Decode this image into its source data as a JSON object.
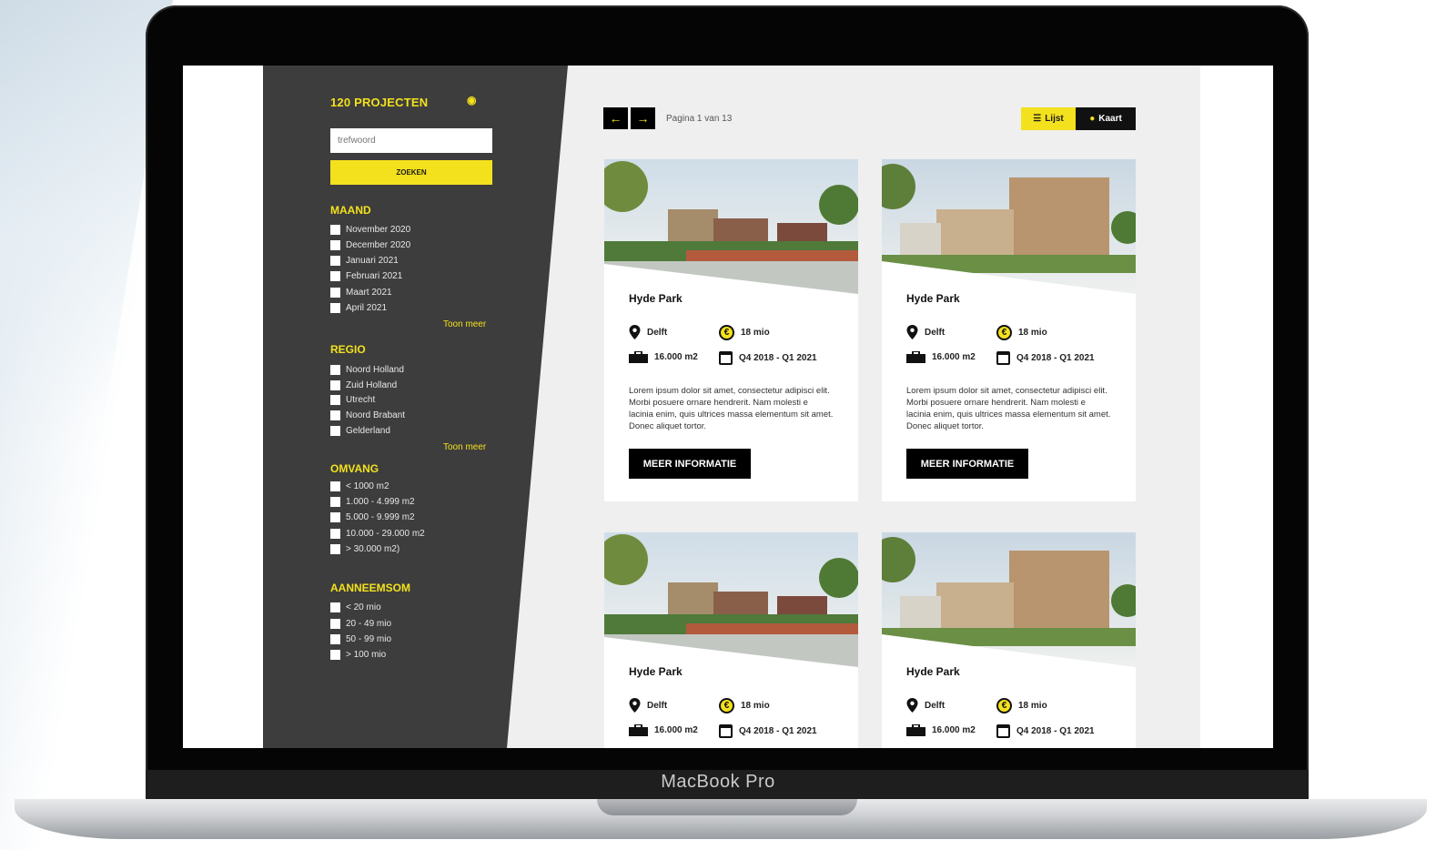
{
  "device": {
    "label": "MacBook Pro"
  },
  "sidebar": {
    "count_label": "120 PROJECTEN",
    "rss_icon": "rss-icon",
    "search": {
      "placeholder": "trefwoord",
      "button_label": "ZOEKEN"
    },
    "filters": [
      {
        "title": "MAAND",
        "options": [
          "November 2020",
          "December 2020",
          "Januari 2021",
          "Februari 2021",
          "Maart 2021",
          "April 2021"
        ],
        "more_label": "Toon meer"
      },
      {
        "title": "REGIO",
        "options": [
          "Noord Holland",
          "Zuid Holland",
          "Utrecht",
          "Noord Brabant",
          "Gelderland"
        ],
        "more_label": "Toon meer"
      },
      {
        "title": "OMVANG",
        "options": [
          "< 1000 m2",
          "1.000 - 4.999 m2",
          "5.000 - 9.999 m2",
          "10.000 - 29.000 m2",
          "> 30.000 m2)"
        ]
      },
      {
        "title": "AANNEEMSOM",
        "options": [
          "< 20 mio",
          "20 - 49 mio",
          "50 - 99 mio",
          "> 100 mio"
        ]
      }
    ]
  },
  "pagination": {
    "label": "Pagina 1 van 13",
    "prev_icon": "arrow-left-icon",
    "next_icon": "arrow-right-icon"
  },
  "view_toggle": {
    "list_label": "Lijst",
    "map_label": "Kaart"
  },
  "colors": {
    "accent": "#f3e11d",
    "sidebar_bg": "#3d3d3d",
    "content_bg": "#efefef"
  },
  "projects": [
    {
      "title": "Hyde Park",
      "location": "Delft",
      "budget": "18 mio",
      "area": "16.000 m2",
      "period": "Q4 2018 - Q1 2021",
      "description": "Lorem ipsum dolor sit amet, consectetur adipisci elit. Morbi posuere ornare hendrerit. Nam molesti e lacinia enim, quis ultrices massa elementum sit amet. Donec aliquet tortor.",
      "button_label": "MEER INFORMATIE"
    },
    {
      "title": "Hyde Park",
      "location": "Delft",
      "budget": "18 mio",
      "area": "16.000 m2",
      "period": "Q4 2018 - Q1 2021",
      "description": "Lorem ipsum dolor sit amet, consectetur adipisci elit. Morbi posuere ornare hendrerit. Nam molesti e lacinia enim, quis ultrices massa elementum sit amet. Donec aliquet tortor.",
      "button_label": "MEER INFORMATIE"
    },
    {
      "title": "Hyde Park",
      "location": "Delft",
      "budget": "18 mio",
      "area": "16.000 m2",
      "period": "Q4 2018 - Q1 2021"
    },
    {
      "title": "Hyde Park",
      "location": "Delft",
      "budget": "18 mio",
      "area": "16.000 m2",
      "period": "Q4 2018 - Q1 2021"
    }
  ]
}
